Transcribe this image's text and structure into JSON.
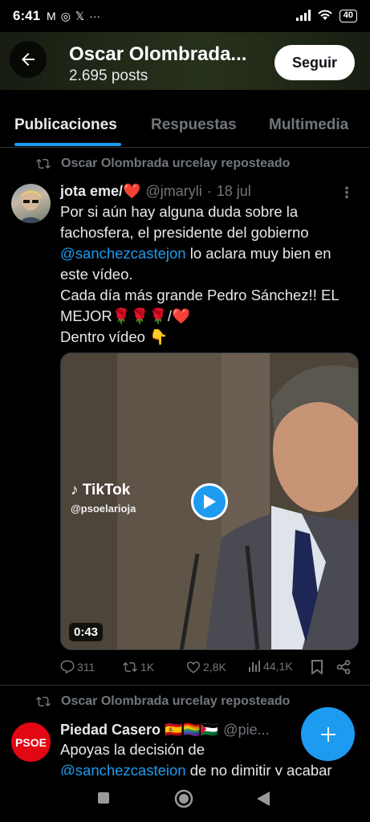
{
  "status_bar": {
    "time": "6:41",
    "left_icons": [
      "M",
      "◎",
      "𝕏",
      "···"
    ],
    "battery": "40"
  },
  "header": {
    "name": "Oscar Olombrada...",
    "posts": "2.695 posts",
    "follow_label": "Seguir"
  },
  "tabs": [
    {
      "label": "Publicaciones",
      "active": true
    },
    {
      "label": "Respuestas",
      "active": false
    },
    {
      "label": "Multimedia",
      "active": false
    }
  ],
  "post1": {
    "repost_label": "Oscar Olombrada urcelay reposteado",
    "author": "jota eme/❤️",
    "handle": "@jmaryli",
    "dot": "·",
    "date": "18 jul",
    "text_line1": "Por si aún hay alguna duda sobre la",
    "text_line2": "fachosfera, el presidente del gobierno",
    "mention": "@sanchezcastejon",
    "text_line3_rest": " lo aclara muy bien en",
    "text_line4": "este vídeo.",
    "text_line5": "Cada día más grande Pedro Sánchez!! EL",
    "text_line6": "MEJOR🌹🌹🌹/❤️",
    "text_line7": "Dentro vídeo 👇",
    "video": {
      "tiktok_label": "TikTok",
      "tiktok_handle": "@psoelarioja",
      "duration": "0:43"
    },
    "actions": {
      "replies": "311",
      "reposts": "1K",
      "likes": "2,8K",
      "views": "44,1K"
    }
  },
  "post2": {
    "repost_label": "Oscar Olombrada urcelay reposteado",
    "avatar_text": "PSOE",
    "author": "Piedad Casero 🇪🇸🏳️‍🌈🇵🇸",
    "handle": "@pie...",
    "text_line1": "Apoyas la decisión de",
    "mention": "@sanchezcasteion",
    "text_line2_rest": " de no dimitir y acabar"
  },
  "colors": {
    "accent": "#1d9bf0",
    "background": "#000000",
    "muted": "#71767b",
    "psoe_red": "#e30613"
  }
}
